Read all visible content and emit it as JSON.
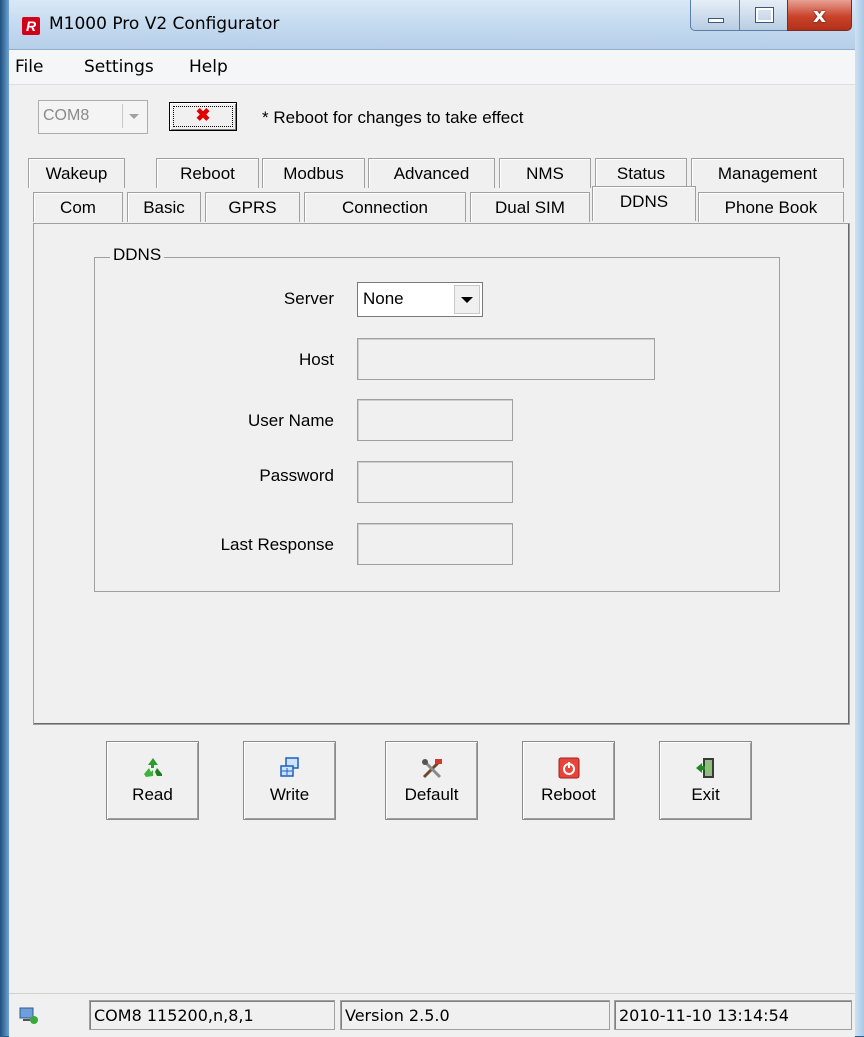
{
  "window": {
    "title": "M1000 Pro V2 Configurator"
  },
  "menu": [
    "File",
    "Settings",
    "Help"
  ],
  "toolbar": {
    "port": "COM8",
    "note": "* Reboot for changes to take effect"
  },
  "tabs_top": [
    "Wakeup",
    "Reboot",
    "Modbus",
    "Advanced",
    "NMS",
    "Status",
    "Management"
  ],
  "tabs_bottom": [
    "Com",
    "Basic",
    "GPRS",
    "Connection",
    "Dual SIM",
    "DDNS",
    "Phone Book"
  ],
  "active_tab": "DDNS",
  "ddns": {
    "group_title": "DDNS",
    "server_label": "Server",
    "server_value": "None",
    "host_label": "Host",
    "host_value": "",
    "user_label": "User Name",
    "user_value": "",
    "password_label": "Password",
    "password_value": "",
    "response_label": "Last Response",
    "response_value": ""
  },
  "buttons": [
    "Read",
    "Write",
    "Default",
    "Reboot",
    "Exit"
  ],
  "status": {
    "port": "COM8 115200,n,8,1",
    "version": "Version 2.5.0",
    "datetime": "2010-11-10 13:14:54"
  }
}
